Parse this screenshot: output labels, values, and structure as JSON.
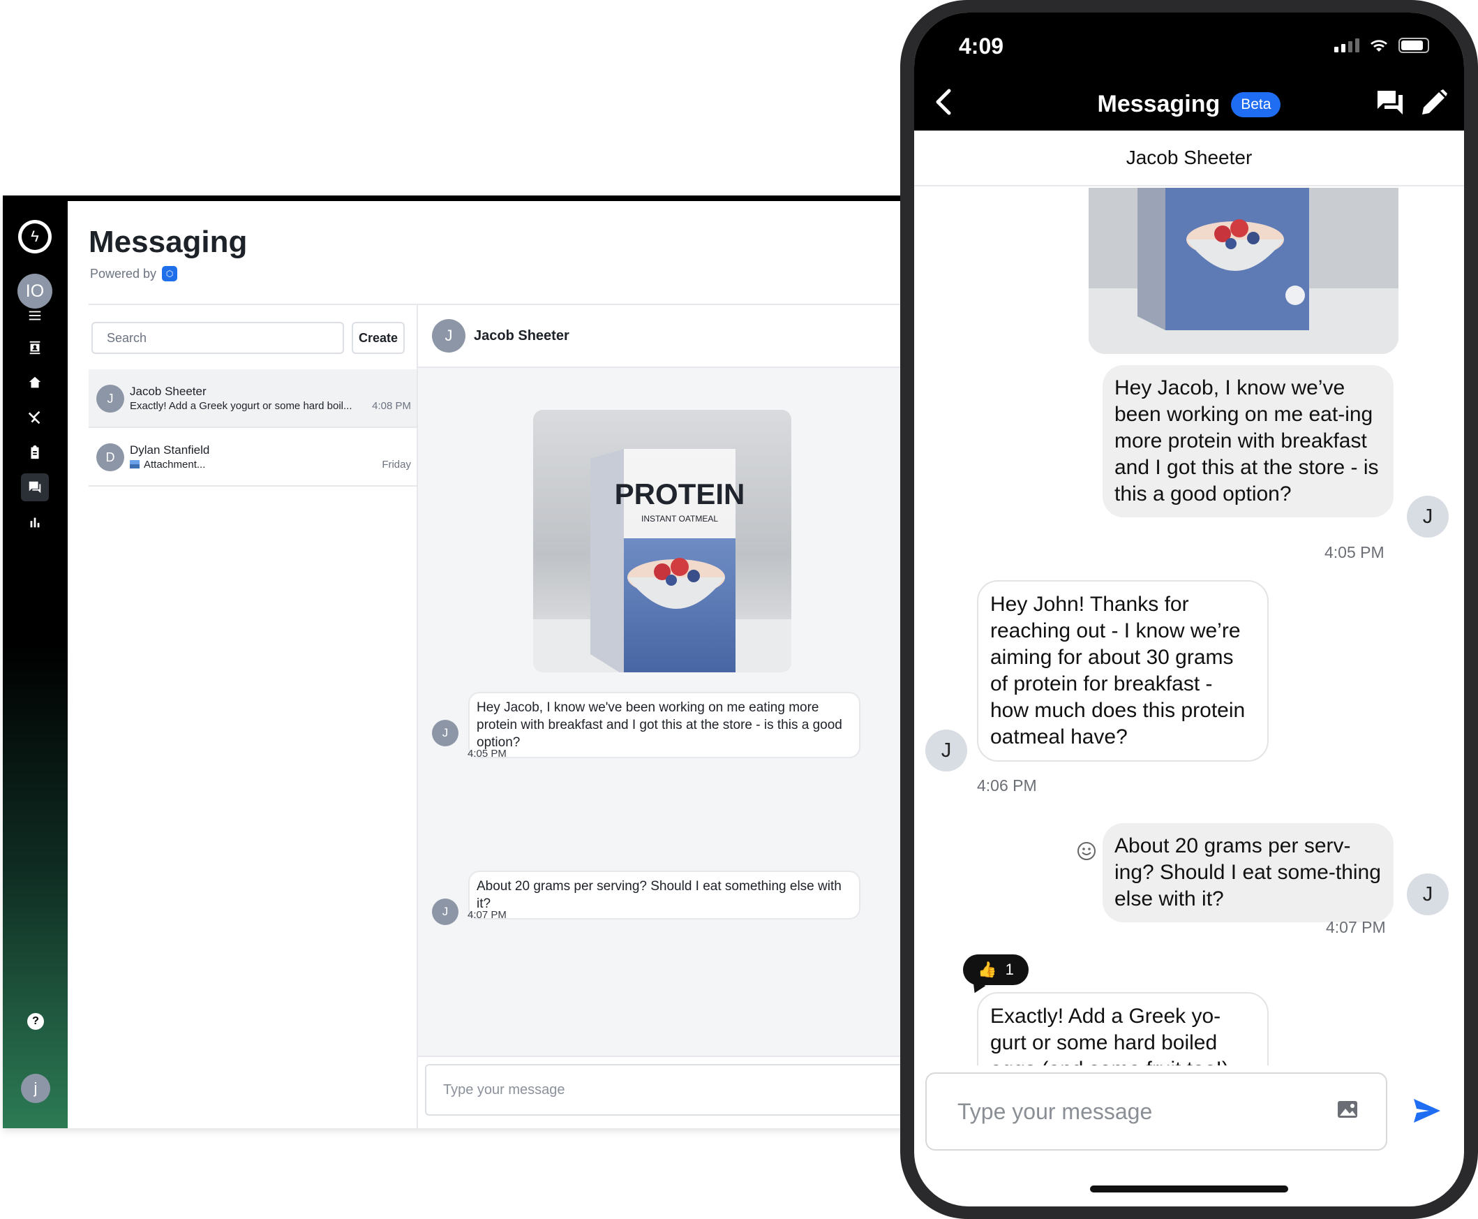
{
  "desktop": {
    "title": "Messaging",
    "powered_by": "Powered by",
    "user_initials": "IO",
    "bottom_user_initial": "j",
    "help_label": "?",
    "search_placeholder": "Search",
    "create_label": "Create",
    "conversations": [
      {
        "initial": "J",
        "name": "Jacob Sheeter",
        "preview": "Exactly! Add a Greek yogurt or some hard boil...",
        "time": "4:08 PM",
        "selected": true
      },
      {
        "initial": "D",
        "name": "Dylan Stanfield",
        "preview": "Attachment...",
        "time": "Friday",
        "selected": false
      }
    ],
    "thread": {
      "initial": "J",
      "name": "Jacob Sheeter",
      "messages": [
        {
          "initial": "J",
          "text": "Hey Jacob, I know we've been working on me eating more protein with breakfast and I got this at the store - is this a good option?",
          "time": "4:05 PM"
        },
        {
          "initial": "J",
          "text": "About 20 grams per serving? Should I eat something else with it?",
          "time": "4:07 PM"
        }
      ],
      "compose_placeholder": "Type your message"
    },
    "product_image": {
      "brand": "PROTEIN",
      "subtitle": "INSTANT OATMEAL"
    }
  },
  "phone": {
    "clock": "4:09",
    "title": "Messaging",
    "beta": "Beta",
    "contact": "Jacob Sheeter",
    "messages": [
      {
        "side": "sent",
        "initial": "J",
        "text": "Hey Jacob, I know we’ve been working on me eat-ing more protein with breakfast and I got this at the store - is this a good option?",
        "time": "4:05 PM"
      },
      {
        "side": "received",
        "initial": "J",
        "text": "Hey John! Thanks for reaching out - I know we’re aiming for about 30 grams of protein for breakfast - how much does this protein oatmeal have?",
        "time": "4:06 PM"
      },
      {
        "side": "sent",
        "initial": "J",
        "text": "About 20 grams per serv-ing? Should I eat some-thing else with it?",
        "time": "4:07 PM"
      },
      {
        "side": "received",
        "initial": "J",
        "text": "Exactly! Add a Greek yo-gurt or some hard boiled eggs (and some fruit too!)"
      }
    ],
    "reaction": {
      "emoji": "👍",
      "count": "1"
    },
    "compose_placeholder": "Type your message"
  }
}
